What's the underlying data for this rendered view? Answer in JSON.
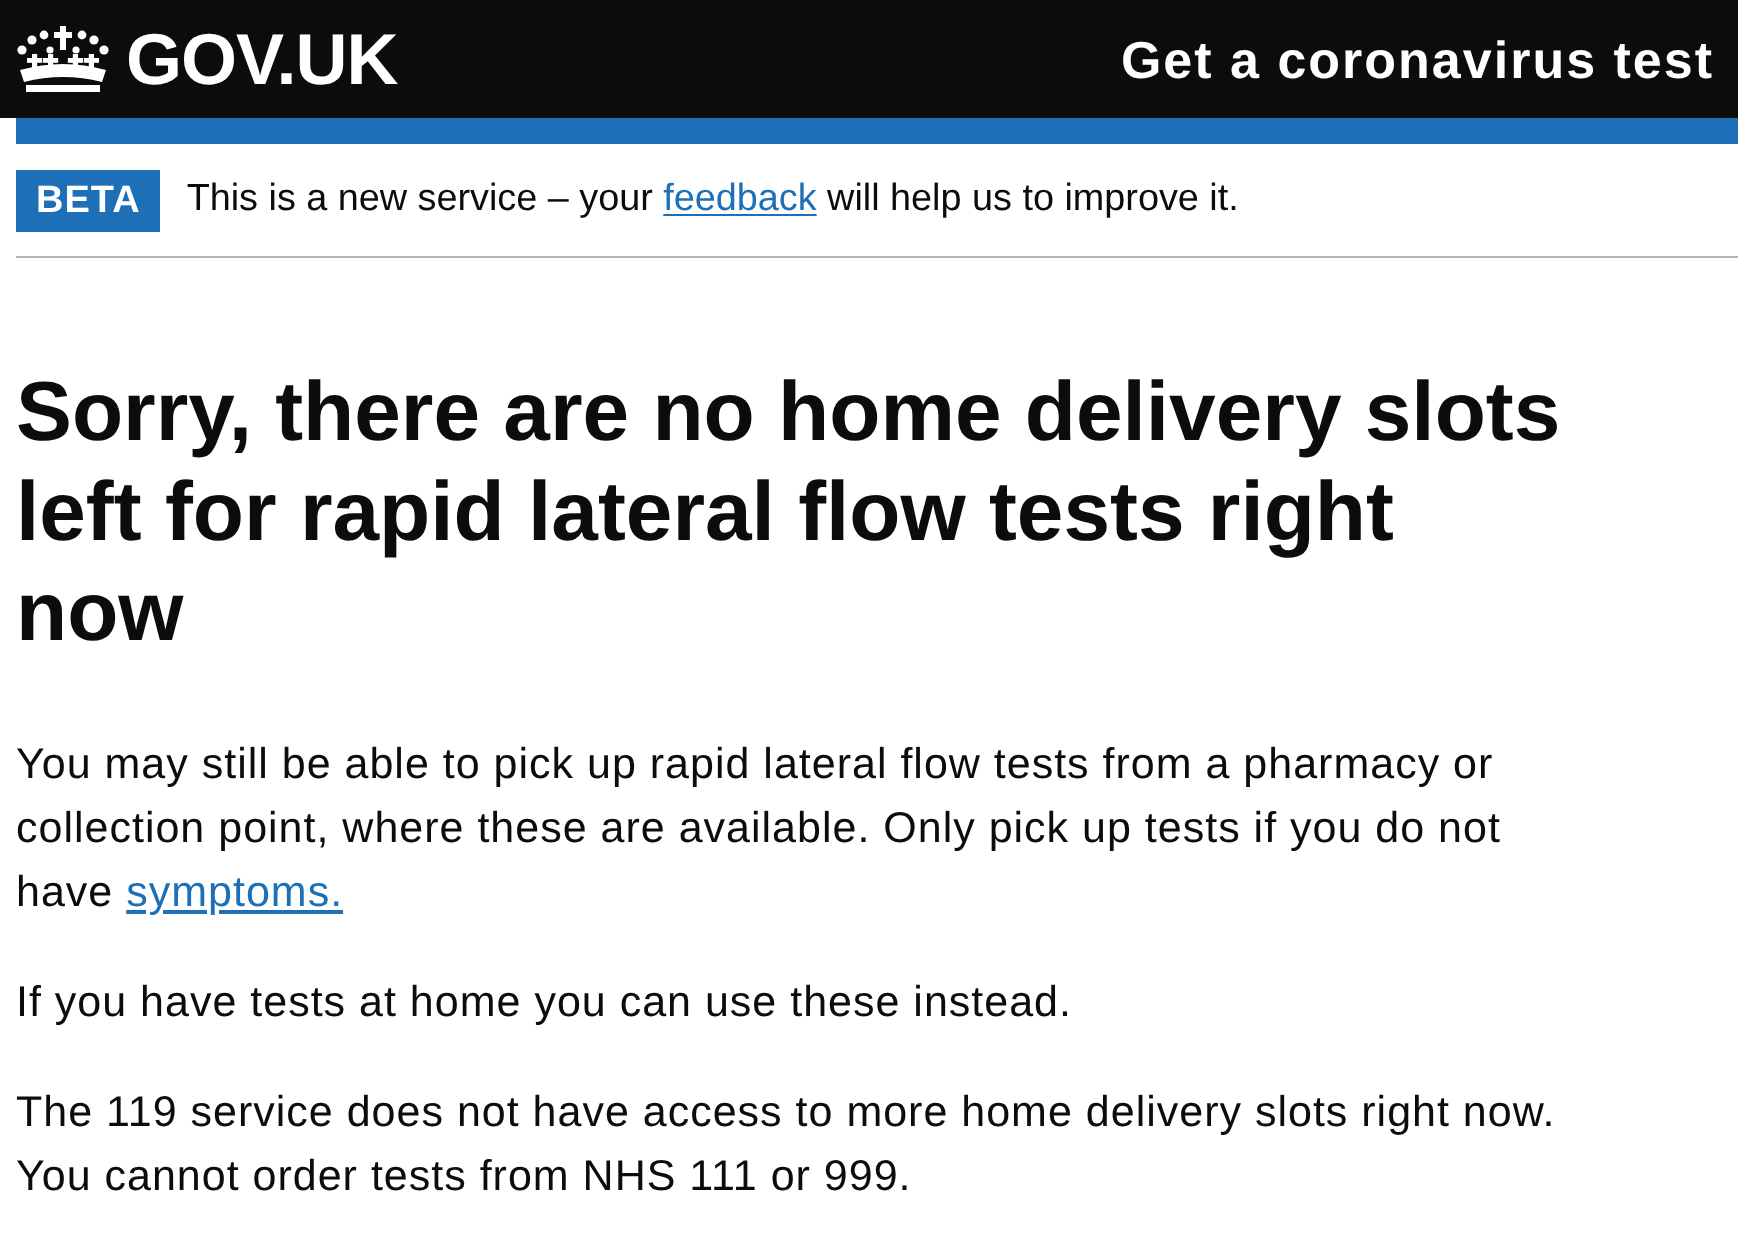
{
  "header": {
    "logo_text": "GOV.UK",
    "service_name": "Get a coronavirus test"
  },
  "phase_banner": {
    "tag": "BETA",
    "text_before": "This is a new service – your",
    "link": "feedback",
    "text_after": "will help us to improve it."
  },
  "heading": "Sorry, there are no home delivery slots left for rapid lateral flow tests right now",
  "paragraphs": [
    {
      "text": "You may still be able to pick up rapid lateral flow tests from a pharmacy or collection point, where these are available. Only pick up tests if you do not have",
      "link": "symptoms."
    },
    {
      "text": "If you have tests at home you can use these instead."
    },
    {
      "text": "The 119 service does not have access to more home delivery slots right now. You cannot order tests from NHS 111 or 999."
    }
  ]
}
